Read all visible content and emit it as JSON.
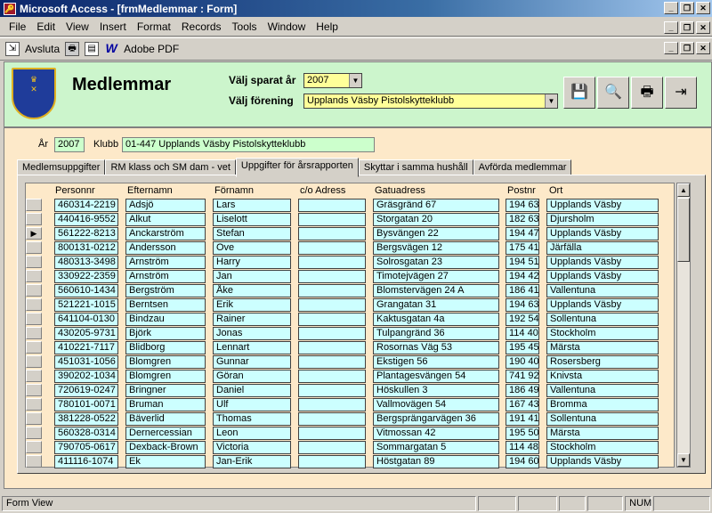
{
  "window": {
    "title": "Microsoft Access - [frmMedlemmar : Form]"
  },
  "menu": [
    "File",
    "Edit",
    "View",
    "Insert",
    "Format",
    "Records",
    "Tools",
    "Window",
    "Help"
  ],
  "toolbar": {
    "exit_label": "Avsluta",
    "pdf_label": "Adobe PDF"
  },
  "header": {
    "title": "Medlemmar",
    "year_label": "Välj sparat år",
    "year_value": "2007",
    "club_label": "Välj förening",
    "club_value": "Upplands Väsby Pistolskytteklubb"
  },
  "fields": {
    "year_label": "År",
    "year_value": "2007",
    "club_label": "Klubb",
    "club_value": "01-447 Upplands Väsby Pistolskytteklubb"
  },
  "tabs": [
    "Medlemsuppgifter",
    "RM klass och SM dam - vet",
    "Uppgifter för årsrapporten",
    "Skyttar i samma hushåll",
    "Avförda medlemmar"
  ],
  "active_tab": 2,
  "columns": [
    "Personnr",
    "Efternamn",
    "Förnamn",
    "c/o Adress",
    "Gatuadress",
    "Postnr",
    "Ort"
  ],
  "current_row": 2,
  "rows": [
    [
      "460314-2219",
      "Adsjö",
      "Lars",
      "",
      "Gräsgränd 67",
      "194 63",
      "Upplands Väsby"
    ],
    [
      "440416-9552",
      "Alkut",
      "Liselott",
      "",
      "Storgatan 20",
      "182 63",
      "Djursholm"
    ],
    [
      "561222-8213",
      "Anckarström",
      "Stefan",
      "",
      "Bysvängen 22",
      "194 47",
      "Upplands Väsby"
    ],
    [
      "800131-0212",
      "Andersson",
      "Ove",
      "",
      "Bergsvägen 12",
      "175 41",
      "Järfälla"
    ],
    [
      "480313-3498",
      "Arnström",
      "Harry",
      "",
      "Solrosgatan 23",
      "194 51",
      "Upplands Väsby"
    ],
    [
      "330922-2359",
      "Arnström",
      "Jan",
      "",
      "Timotejvägen 27",
      "194 42",
      "Upplands Väsby"
    ],
    [
      "560610-1434",
      "Bergström",
      "Åke",
      "",
      "Blomstervägen 24 A",
      "186 41",
      "Vallentuna"
    ],
    [
      "521221-1015",
      "Berntsen",
      "Erik",
      "",
      "Grangatan 31",
      "194 63",
      "Upplands Väsby"
    ],
    [
      "641104-0130",
      "Bindzau",
      "Rainer",
      "",
      "Kaktusgatan 4a",
      "192 54",
      "Sollentuna"
    ],
    [
      "430205-9731",
      "Björk",
      "Jonas",
      "",
      "Tulpangränd 36",
      "114 40",
      "Stockholm"
    ],
    [
      "410221-7117",
      "Blidborg",
      "Lennart",
      "",
      "Rosornas Väg 53",
      "195 45",
      "Märsta"
    ],
    [
      "451031-1056",
      "Blomgren",
      "Gunnar",
      "",
      "Ekstigen 56",
      "190 40",
      "Rosersberg"
    ],
    [
      "390202-1034",
      "Blomgren",
      "Göran",
      "",
      "Plantagesvängen 54",
      "741 92",
      "Knivsta"
    ],
    [
      "720619-0247",
      "Bringner",
      "Daniel",
      "",
      "Höskullen 3",
      "186 49",
      "Vallentuna"
    ],
    [
      "780101-0071",
      "Bruman",
      "Ulf",
      "",
      "Vallmovägen 54",
      "167 43",
      "Bromma"
    ],
    [
      "381228-0522",
      "Bäverlid",
      "Thomas",
      "",
      "Bergsprängarvägen 36",
      "191 41",
      "Sollentuna"
    ],
    [
      "560328-0314",
      "Dernercessian",
      "Leon",
      "",
      "Vitmossan 42",
      "195 50",
      "Märsta"
    ],
    [
      "790705-0617",
      "Dexback-Brown",
      "Victoria",
      "",
      "Sommargatan 5",
      "114 48",
      "Stockholm"
    ],
    [
      "411116-1074",
      "Ek",
      "Jan-Erik",
      "",
      "Höstgatan 89",
      "194 60",
      "Upplands Väsby"
    ]
  ],
  "status": {
    "mode": "Form View",
    "num": "NUM"
  }
}
